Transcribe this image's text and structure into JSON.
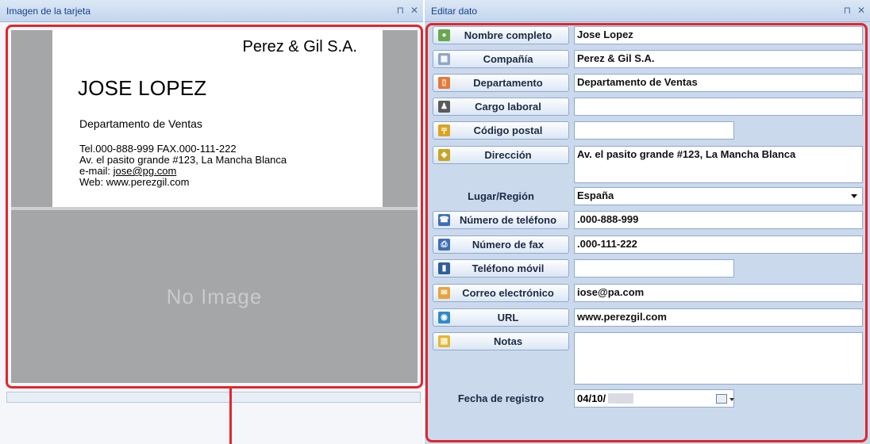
{
  "left_panel": {
    "title": "Imagen de la tarjeta",
    "pin_icon": "⊓",
    "close_icon": "✕",
    "card": {
      "company": "Perez & Gil S.A.",
      "name": "JOSE LOPEZ",
      "department": "Departamento de Ventas",
      "phone_fax": "Tel.000-888-999   FAX.000-111-222",
      "address": "Av. el pasito grande #123, La Mancha Blanca",
      "email_prefix": "e-mail: ",
      "email": "jose@pg.com",
      "web": "Web: www.perezgil.com"
    },
    "no_image": "No Image"
  },
  "right_panel": {
    "title": "Editar dato",
    "pin_icon": "⊓",
    "close_icon": "✕",
    "fields": [
      {
        "label": "Nombre completo",
        "value": "Jose Lopez",
        "icon": "person-icon",
        "icon_color": "#6aa84f"
      },
      {
        "label": "Compañía",
        "value": "Perez & Gil S.A.",
        "icon": "building-icon",
        "icon_color": "#8ea6c7"
      },
      {
        "label": "Departamento",
        "value": "Departamento de Ventas",
        "icon": "door-icon",
        "icon_color": "#e07b39"
      },
      {
        "label": "Cargo laboral",
        "value": "",
        "icon": "chess-piece-icon",
        "icon_color": "#5a5a5a"
      },
      {
        "label": "Código postal",
        "value": "",
        "icon": "postal-icon",
        "icon_color": "#d9a521"
      },
      {
        "label": "Dirección",
        "value": "Av. el pasito grande #123, La Mancha Blanca",
        "icon": "map-icon",
        "icon_color": "#c9a227"
      },
      {
        "label": "Lugar/Región",
        "value": "España"
      },
      {
        "label": "Número de teléfono",
        "value": ".000-888-999",
        "icon": "phone-icon",
        "icon_color": "#3d6fb5"
      },
      {
        "label": "Número de fax",
        "value": ".000-111-222",
        "icon": "fax-icon",
        "icon_color": "#3d6fb5"
      },
      {
        "label": "Teléfono móvil",
        "value": "",
        "icon": "mobile-icon",
        "icon_color": "#2f5e9e"
      },
      {
        "label": "Correo electrónico",
        "value": "iose@pa.com",
        "icon": "mail-icon",
        "icon_color": "#e8a33c"
      },
      {
        "label": "URL",
        "value": "www.perezgil.com",
        "icon": "globe-icon",
        "icon_color": "#2e8bc9"
      },
      {
        "label": "Notas",
        "value": "",
        "icon": "notes-icon",
        "icon_color": "#e5b82b"
      }
    ],
    "registration": {
      "label": "Fecha de registro",
      "value": "04/10/"
    }
  }
}
